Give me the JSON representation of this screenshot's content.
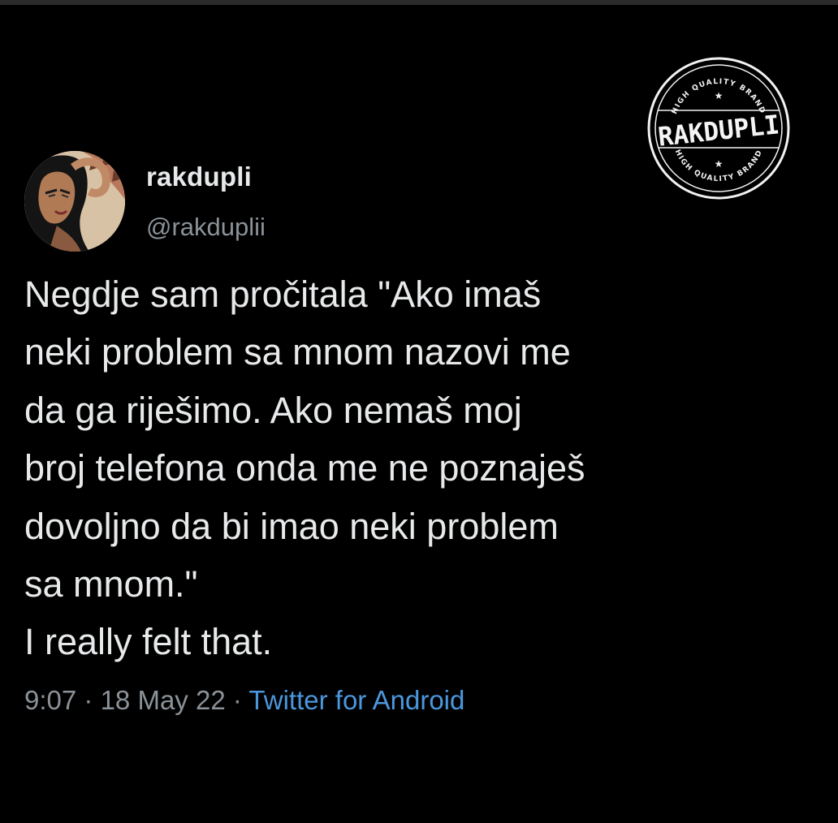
{
  "tweet": {
    "display_name": "rakdupli",
    "handle": "@rakduplii",
    "lines": [
      "Negdje sam pročitala \"Ako imaš",
      "neki problem sa mnom nazovi me",
      "da ga riješimo. Ako nemaš moj",
      "broj telefona onda me ne poznaješ",
      "dovoljno da bi imao neki problem",
      "sa mnom.\"",
      "I really felt that."
    ],
    "time": "9:07",
    "separator": "·",
    "date": "18 May 22",
    "source": "Twitter for Android"
  },
  "watermark": {
    "brand": "RAKDUPLI",
    "top_text": "HIGH QUALITY BRAND",
    "bottom_text": "HIGH QUALITY BRAND"
  },
  "colors": {
    "background": "#000000",
    "text": "#e7e9ea",
    "muted": "#8b9298",
    "link": "#4b97dd"
  },
  "icons": {
    "avatar": "profile-photo",
    "watermark": "brand-stamp"
  }
}
